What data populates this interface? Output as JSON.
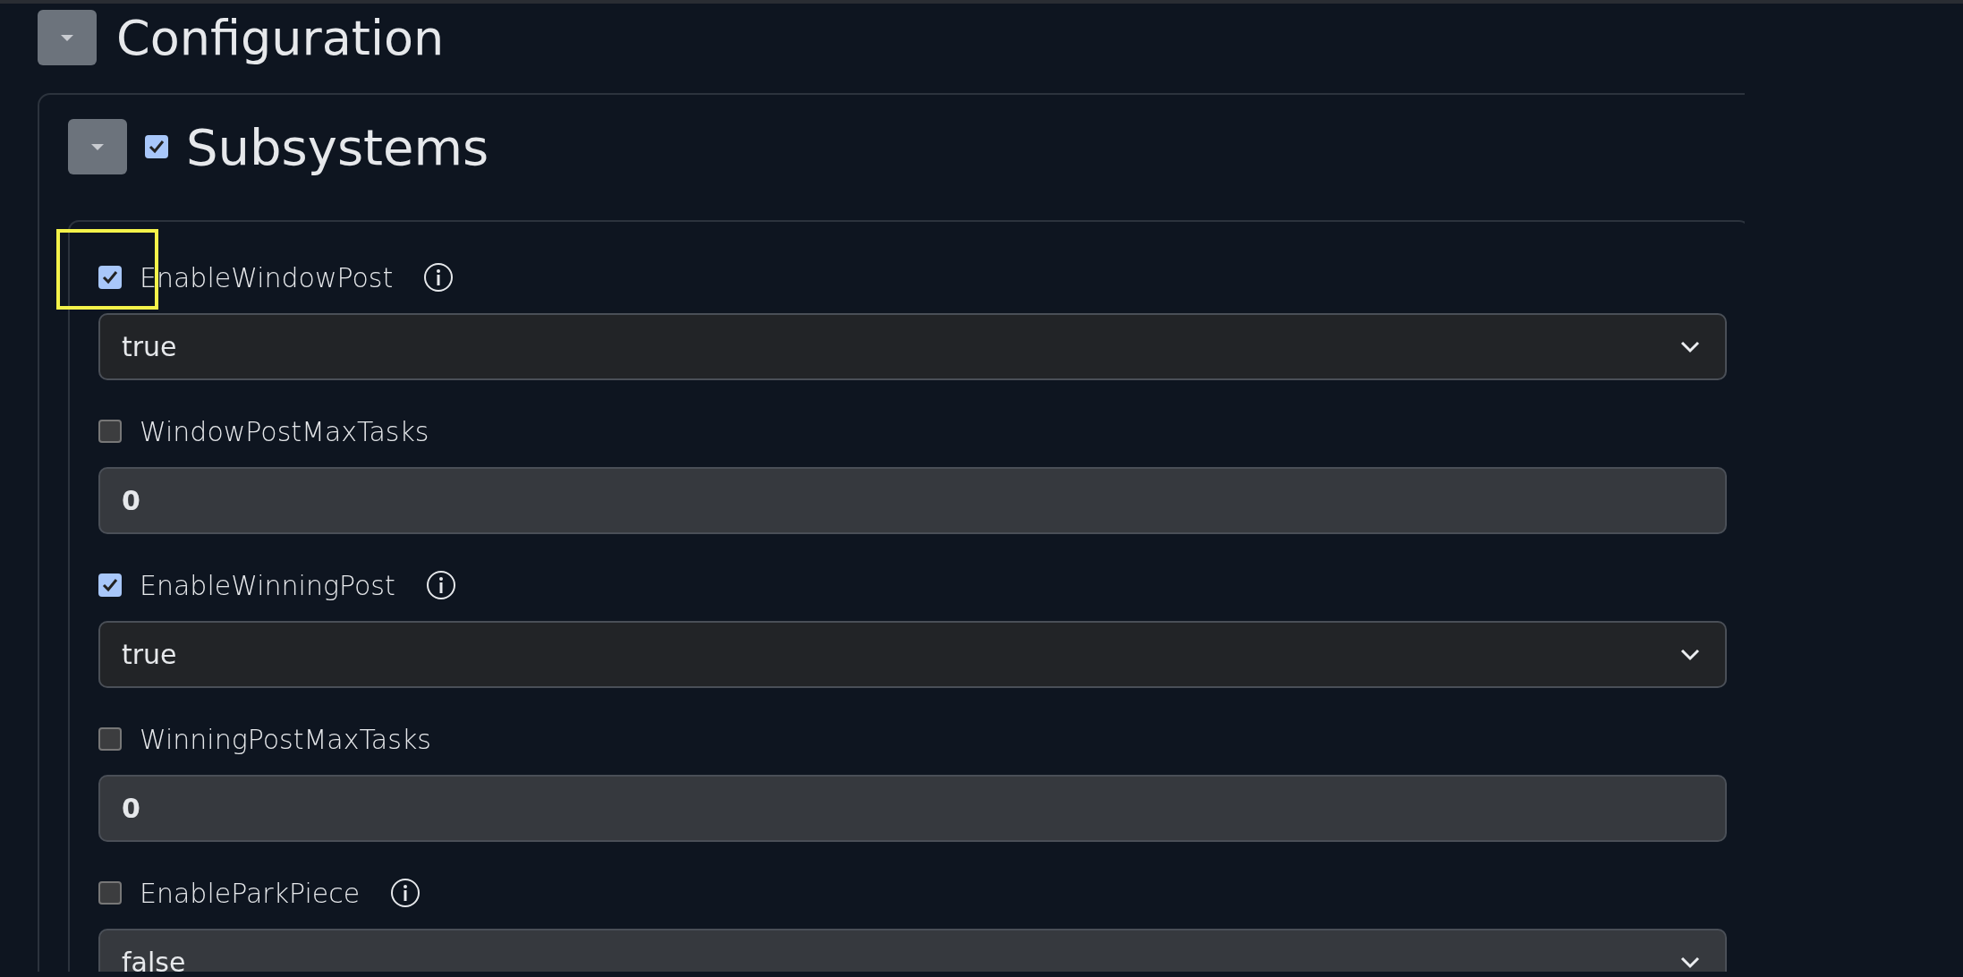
{
  "section": {
    "title": "Configuration",
    "expanded": true
  },
  "group": {
    "title": "Subsystems",
    "expanded": true,
    "checked": true
  },
  "items": [
    {
      "label": "EnableWindowPost",
      "checked": true,
      "kind": "select",
      "info": true,
      "value": "true",
      "highlighted": true
    },
    {
      "label": "WindowPostMaxTasks",
      "checked": false,
      "kind": "number",
      "info": false,
      "value": "0",
      "highlighted": false
    },
    {
      "label": "EnableWinningPost",
      "checked": true,
      "kind": "select",
      "info": true,
      "value": "true",
      "highlighted": false
    },
    {
      "label": "WinningPostMaxTasks",
      "checked": false,
      "kind": "number",
      "info": false,
      "value": "0",
      "highlighted": false
    },
    {
      "label": "EnableParkPiece",
      "checked": false,
      "kind": "select",
      "info": true,
      "value": "false",
      "highlighted": false
    }
  ]
}
